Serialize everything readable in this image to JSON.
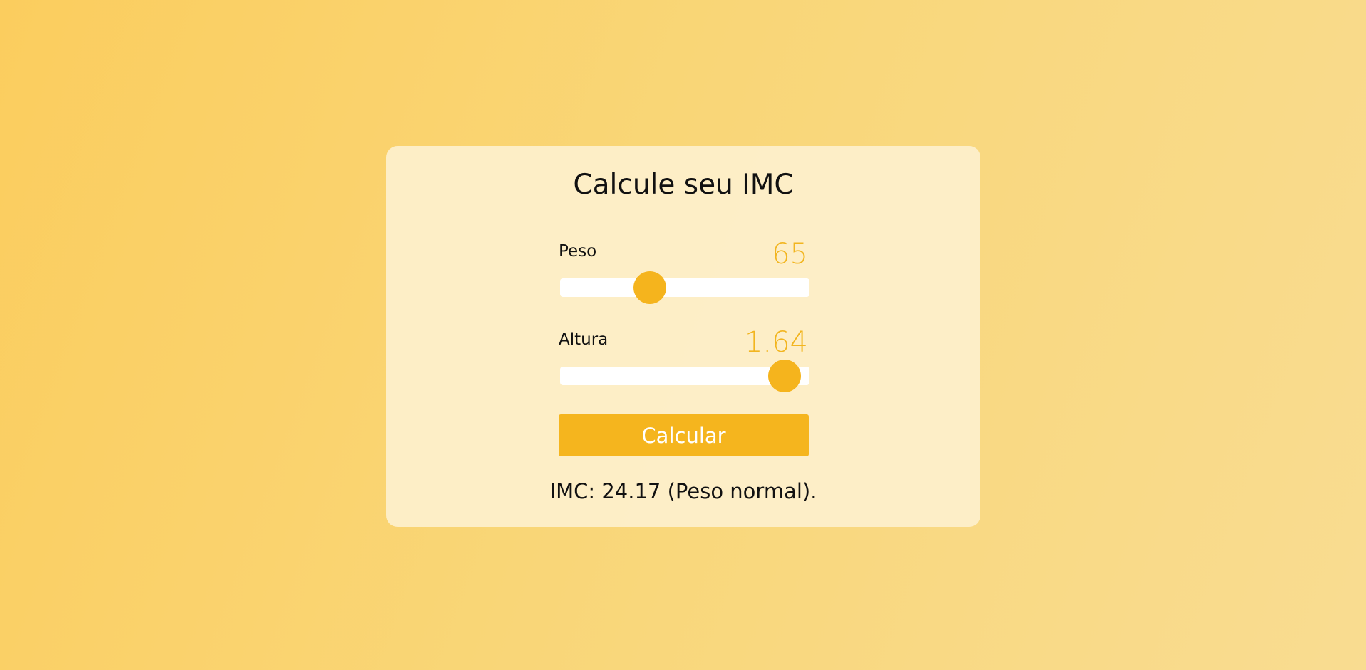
{
  "form": {
    "title": "Calcule seu IMC",
    "peso": {
      "label": "Peso",
      "value": "65",
      "slider_fraction": 0.36
    },
    "altura": {
      "label": "Altura",
      "value": "1.64",
      "slider_fraction": 0.9
    },
    "button_label": "Calcular",
    "result": "IMC: 24.17 (Peso normal)."
  },
  "colors": {
    "accent": "#f5b51e",
    "track": "#ffffff",
    "card": "#fdf0cd"
  }
}
